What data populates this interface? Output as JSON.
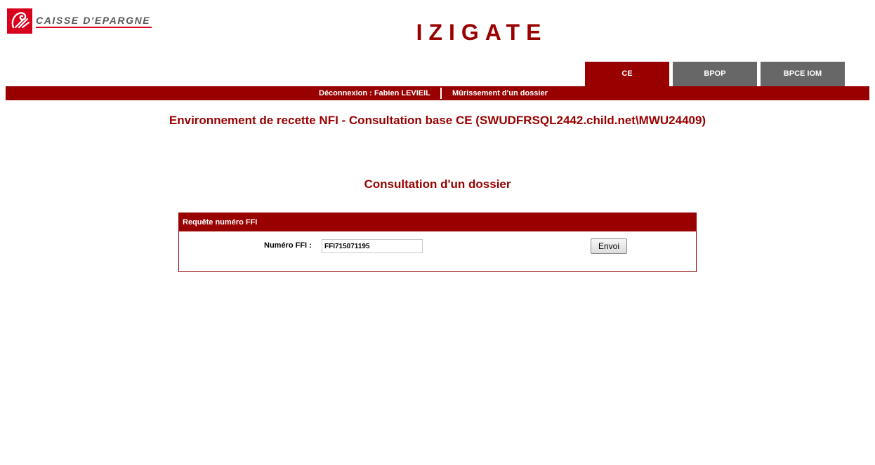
{
  "brand": {
    "logo_text": "CAISSE D'EPARGNE",
    "color": "#d8001c"
  },
  "app": {
    "title": "IZIGATE",
    "accent_color": "#990000"
  },
  "tabs": [
    {
      "label": "CE",
      "active": true
    },
    {
      "label": "BPOP",
      "active": false
    },
    {
      "label": "BPCE IOM",
      "active": false
    }
  ],
  "nav": {
    "logout_label": "Déconnexion : Fabien LEVIEIL",
    "maturation_label": "Mûrissement d'un dossier"
  },
  "environment_title": "Environnement de recette NFI - Consultation base CE (SWUDFRSQL2442.child.net\\MWU24409)",
  "page_title": "Consultation d'un dossier",
  "form": {
    "header": "Requête numéro FFI",
    "field_label": "Numéro FFI :",
    "field_value": "FFI715071195",
    "submit_label": "Envoi"
  }
}
